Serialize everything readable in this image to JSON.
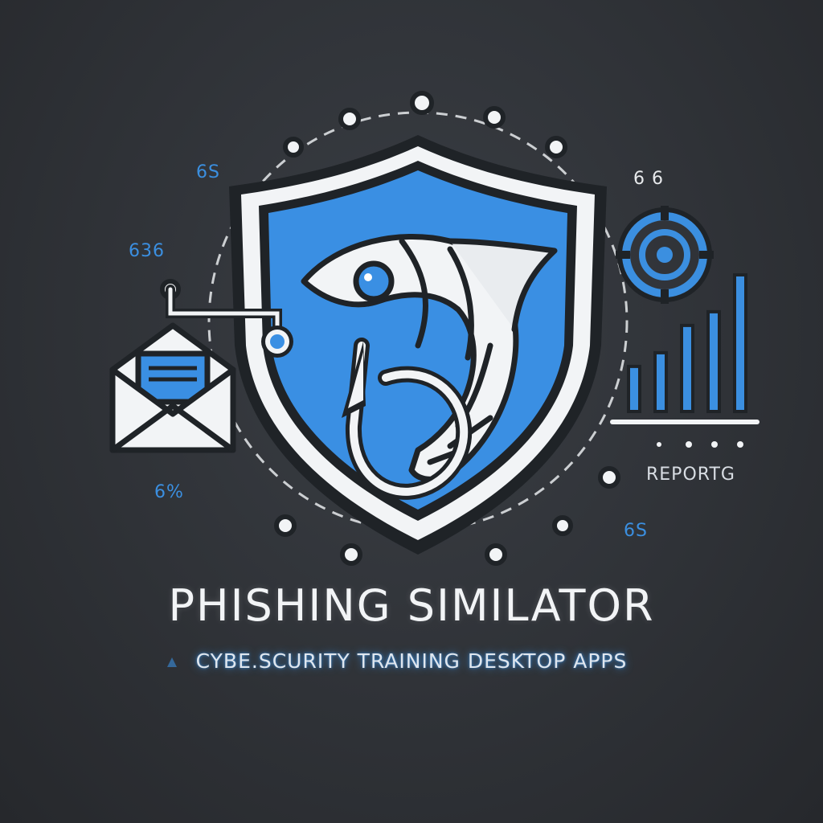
{
  "colors": {
    "background": "#2f3237",
    "accent_blue": "#3b8fe0",
    "shield_blue": "#3a8fe3",
    "white": "#f2f4f6",
    "outline": "#1f2327"
  },
  "title": "PHISHING SIMILATOR",
  "subtitle": "CYBE.SCURITY TRAINING DESKTOP APPS",
  "labels": {
    "top_left": "6S",
    "left_upper": "636",
    "left_lower": "6%",
    "top_right": "6 6",
    "reporting": "REPORTG",
    "bottom_right": "6S"
  },
  "icons": {
    "shield": "shield-icon",
    "fish": "fish-icon",
    "hook": "fishhook-icon",
    "envelope": "email-envelope-icon",
    "target": "target-icon",
    "chart": "bar-chart-icon"
  },
  "chart_levels": [
    0.33,
    0.43,
    0.63,
    0.73,
    1.0
  ]
}
